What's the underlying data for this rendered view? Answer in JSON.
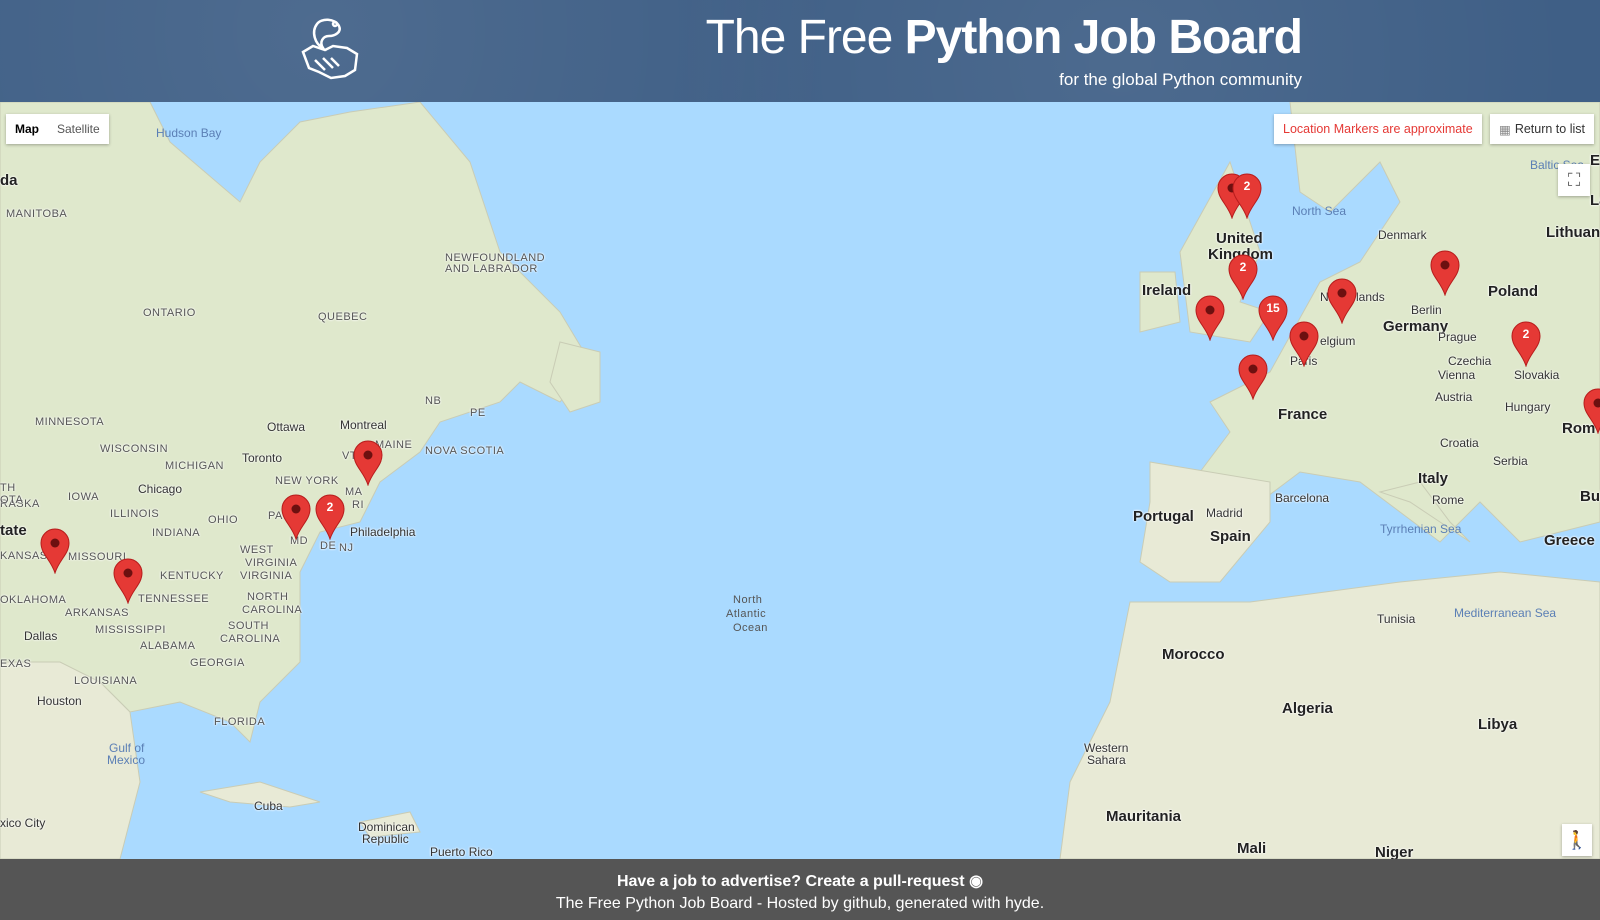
{
  "header": {
    "title_light": "The Free ",
    "title_bold": "Python Job Board",
    "subtitle": "for the global Python community",
    "logo_icon": "handshake-python-icon"
  },
  "map": {
    "type_buttons": [
      "Map",
      "Satellite"
    ],
    "notice": "Location Markers are approximate",
    "return_label": "Return to list",
    "labels": [
      "Hudson Bay",
      "da",
      "MANITOBA",
      "ONTARIO",
      "QUEBEC",
      "NEWFOUNDLAND",
      "AND LABRADOR",
      "NB",
      "PE",
      "NOVA SCOTIA",
      "MAINE",
      "Ottawa",
      "Montreal",
      "Toronto",
      "NEW YORK",
      "VT",
      "MA",
      "RI",
      "PA",
      "Philadelphia",
      "MD",
      "DE",
      "NJ",
      "MINNESOTA",
      "WISCONSIN",
      "MICHIGAN",
      "IOWA",
      "Chicago",
      "ILLINOIS",
      "INDIANA",
      "OHIO",
      "WEST",
      "VIRGINIA",
      "VIRGINIA",
      "KENTUCKY",
      "MISSOURI",
      "KANSAS",
      "tate",
      "RASKA",
      "TH",
      "OTA",
      "OKLAHOMA",
      "ARKANSAS",
      "TENNESSEE",
      "NORTH",
      "CAROLINA",
      "SOUTH",
      "CAROLINA",
      "MISSISSIPPI",
      "ALABAMA",
      "GEORGIA",
      "Dallas",
      "EXAS",
      "LOUISIANA",
      "Houston",
      "FLORIDA",
      "Gulf of",
      "Mexico",
      "Cuba",
      "Dominican",
      "Republic",
      "Puerto Rico",
      "xico City",
      "North",
      "Atlantic",
      "Ocean",
      "North Sea",
      "Baltic Sea",
      "Est",
      "La",
      "Lithuan",
      "Denmark",
      "United",
      "Kingdom",
      "Ireland",
      "Netherlands",
      "Berlin",
      "Poland",
      "Germany",
      "elgium",
      "Paris",
      "Prague",
      "Czechia",
      "Vienna",
      "Slovakia",
      "Austria",
      "Hungary",
      "France",
      "Croatia",
      "Rom",
      "Serbia",
      "Italy",
      "Rome",
      "Bulg",
      "Portugal",
      "Madrid",
      "Spain",
      "Barcelona",
      "Tyrrhenian Sea",
      "Greece",
      "Tunisia",
      "Mediterranean Sea",
      "Morocco",
      "Algeria",
      "Libya",
      "Western",
      "Sahara",
      "Mauritania",
      "Mali",
      "Niger"
    ],
    "markers": [
      {
        "count": ""
      },
      {
        "count": "2"
      },
      {
        "count": "2"
      },
      {
        "count": ""
      },
      {
        "count": "15"
      },
      {
        "count": ""
      },
      {
        "count": ""
      },
      {
        "count": ""
      },
      {
        "count": ""
      },
      {
        "count": "2"
      },
      {
        "count": ""
      },
      {
        "count": ""
      },
      {
        "count": ""
      },
      {
        "count": "2"
      },
      {
        "count": ""
      },
      {
        "count": ""
      }
    ],
    "marker_color": "#e53935",
    "ocean_color": "#aadaff"
  },
  "footer": {
    "cta": "Have a job to advertise? Create a pull-request",
    "github_icon": "github-octocat-icon",
    "credit": "The Free Python Job Board - Hosted by github, generated with hyde."
  }
}
